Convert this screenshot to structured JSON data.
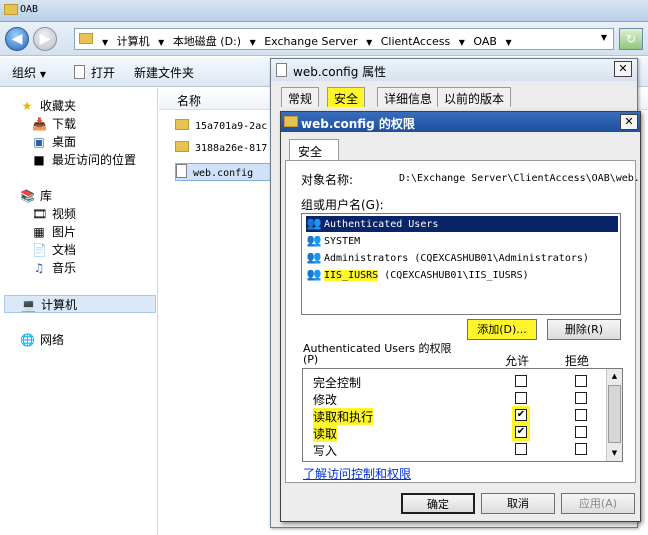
{
  "window": {
    "title": "OAB"
  },
  "address": {
    "crumbs": [
      "计算机",
      "本地磁盘 (D:)",
      "Exchange Server",
      "ClientAccess",
      "OAB"
    ]
  },
  "toolbar": {
    "organize": "组织",
    "open": "打开",
    "new_folder": "新建文件夹"
  },
  "nav": {
    "favorites": "收藏夹",
    "downloads": "下载",
    "desktop": "桌面",
    "recent": "最近访问的位置",
    "libraries": "库",
    "videos": "视频",
    "pictures": "图片",
    "documents": "文档",
    "music": "音乐",
    "computer": "计算机",
    "network": "网络"
  },
  "content": {
    "column_name": "名称",
    "files": [
      "15a701a9-2ac",
      "3188a26e-817",
      "web.config"
    ]
  },
  "properties": {
    "title": "web.config 属性",
    "tabs": [
      "常规",
      "安全",
      "详细信息",
      "以前的版本"
    ]
  },
  "permissions": {
    "title": "web.config 的权限",
    "tab": "安全",
    "object_name_label": "对象名称:",
    "object_name_value": "D:\\Exchange Server\\ClientAccess\\OAB\\web.",
    "group_label": "组或用户名(G):",
    "groups": [
      {
        "name": "Authenticated Users",
        "suffix": ""
      },
      {
        "name": "SYSTEM",
        "suffix": ""
      },
      {
        "name": "Administrators",
        "suffix": " (CQEXCASHUB01\\Administrators)"
      },
      {
        "name": "IIS_IUSRS",
        "suffix": " (CQEXCASHUB01\\IIS_IUSRS)"
      }
    ],
    "add_button": "添加(D)...",
    "remove_button": "删除(R)",
    "perm_label_line1": "Authenticated Users 的权限",
    "perm_label_line2": "(P)",
    "allow_header": "允许",
    "deny_header": "拒绝",
    "rows": [
      {
        "name": "完全控制",
        "allow": false,
        "deny": false
      },
      {
        "name": "修改",
        "allow": false,
        "deny": false
      },
      {
        "name": "读取和执行",
        "allow": true,
        "deny": false
      },
      {
        "name": "读取",
        "allow": true,
        "deny": false
      },
      {
        "name": "写入",
        "allow": false,
        "deny": false
      }
    ],
    "link": "了解访问控制和权限",
    "ok": "确定",
    "cancel": "取消",
    "apply": "应用(A)"
  }
}
